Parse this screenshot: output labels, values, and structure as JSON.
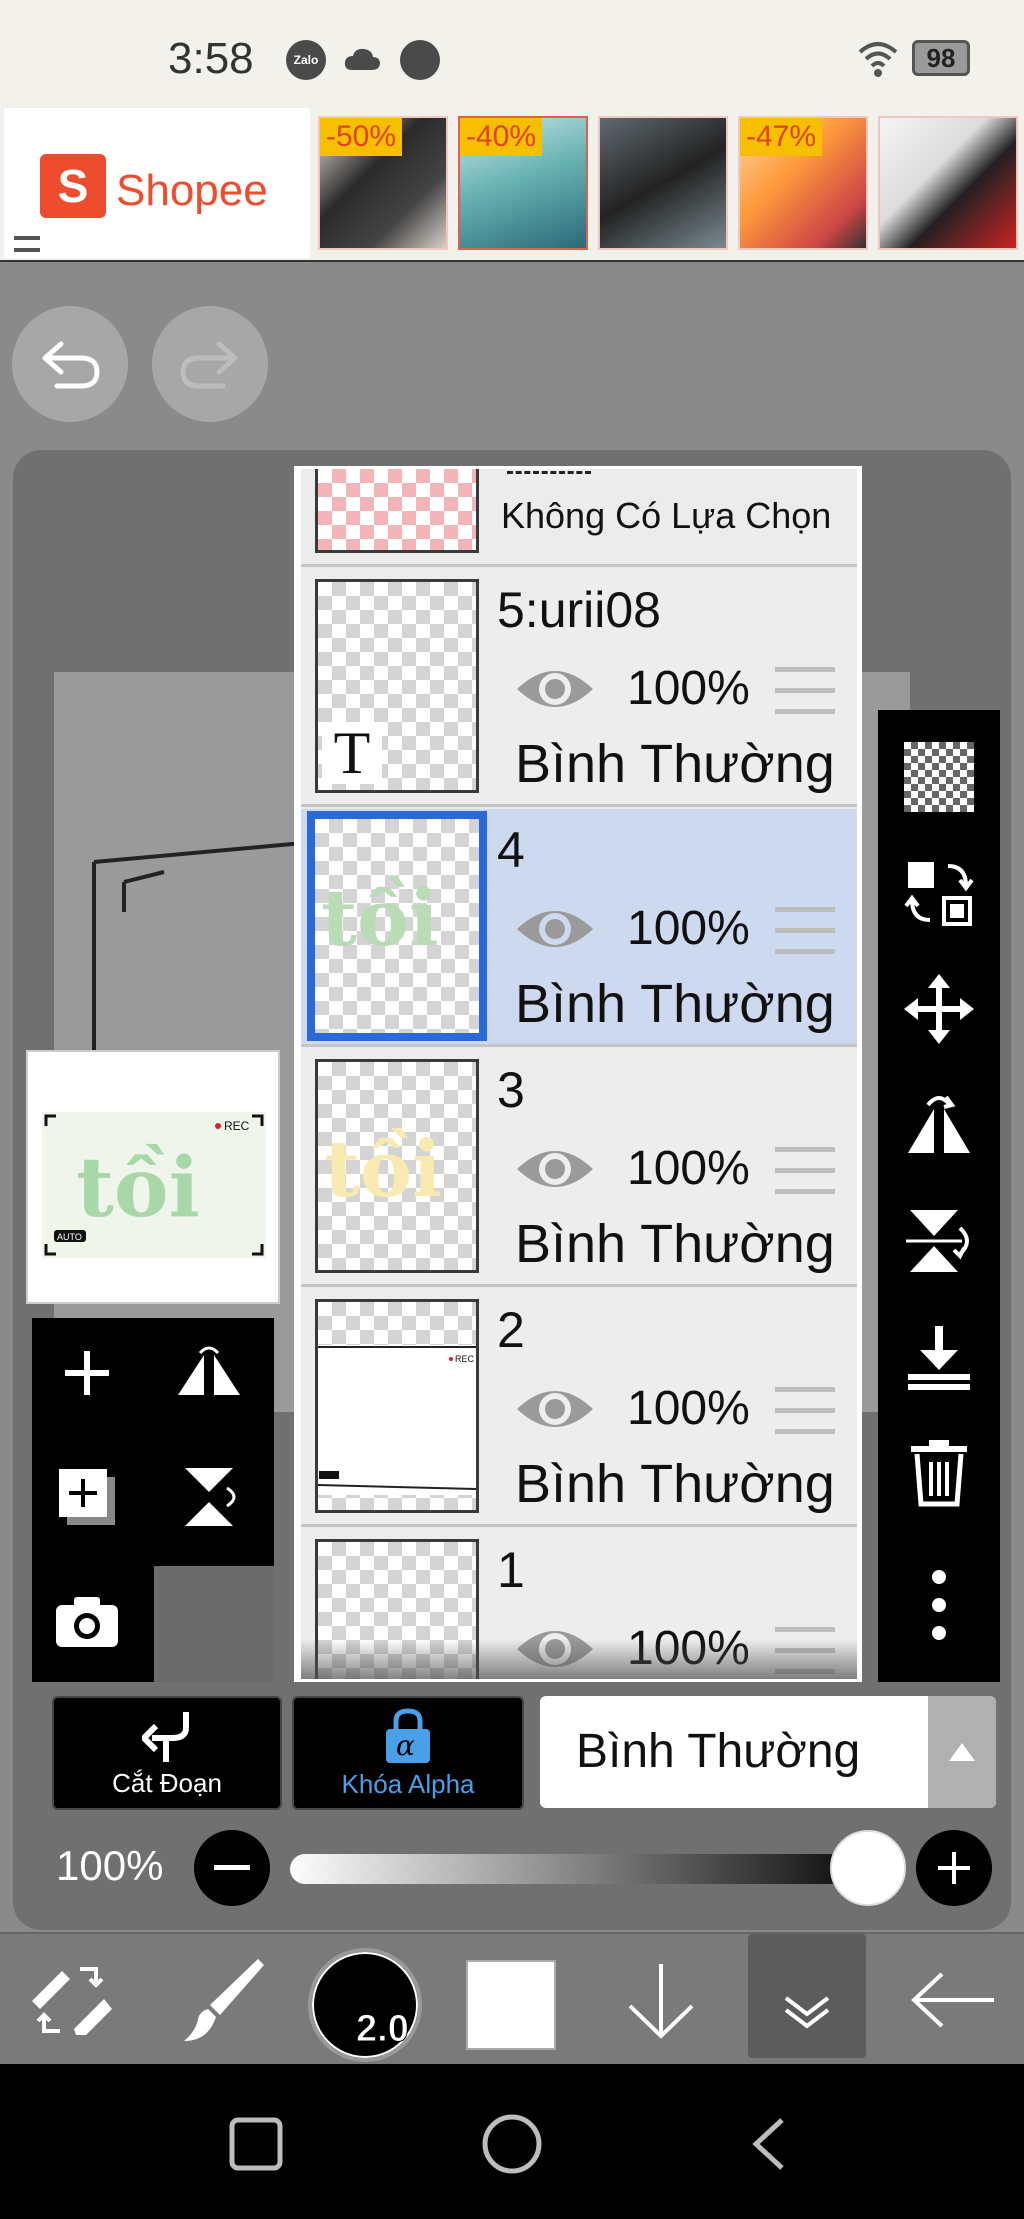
{
  "status_bar": {
    "time": "3:58",
    "zalo_label": "Zalo",
    "battery": "98"
  },
  "ad_banner": {
    "brand": "Shopee",
    "brand_color": "#ee4d2d",
    "items": [
      {
        "badge": "-50%"
      },
      {
        "badge": "-40%"
      },
      {
        "badge": ""
      },
      {
        "badge": "-47%"
      },
      {
        "badge": ""
      }
    ]
  },
  "layers_panel": {
    "partial_layer": {
      "label": "Không Có Lựa Chọn"
    },
    "layers": [
      {
        "name": "5:urii08",
        "opacity": "100%",
        "blend": "Bình Thường",
        "selected": false,
        "thumb_text": "T"
      },
      {
        "name": "4",
        "opacity": "100%",
        "blend": "Bình Thường",
        "selected": true,
        "thumb_text": "tồi"
      },
      {
        "name": "3",
        "opacity": "100%",
        "blend": "Bình Thường",
        "selected": false,
        "thumb_text": "tồi"
      },
      {
        "name": "2",
        "opacity": "100%",
        "blend": "Bình Thường",
        "selected": false,
        "thumb_text": "REC"
      },
      {
        "name": "1",
        "opacity": "100%",
        "blend": "",
        "selected": false,
        "thumb_text": ""
      }
    ],
    "selected_color": "#2a6ad8"
  },
  "preview": {
    "rec": "REC",
    "word": "tồi",
    "auto": "AUTO"
  },
  "actions": {
    "clip_label": "Cắt Đoạn",
    "alpha_lock_label": "Khóa Alpha",
    "alpha_lock_color": "#4aa0e8",
    "blend_mode": "Bình Thường"
  },
  "opacity_slider": {
    "label": "100%",
    "value": 1.0
  },
  "toolbar": {
    "brush_size": "2.0",
    "color": "#ffffff"
  }
}
